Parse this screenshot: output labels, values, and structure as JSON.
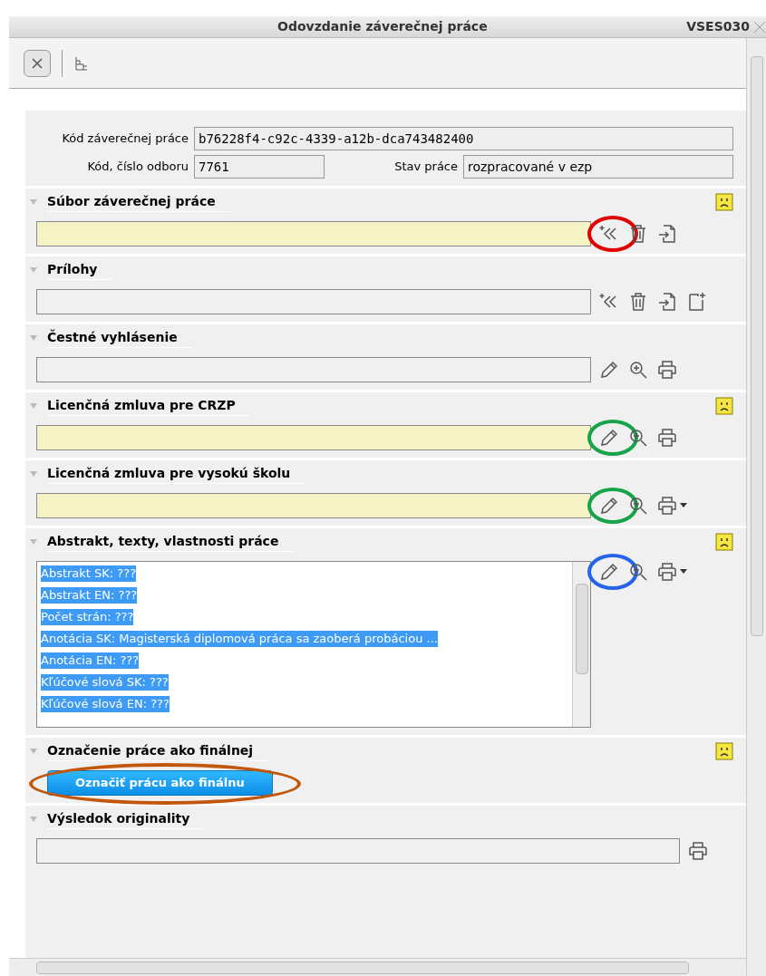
{
  "window": {
    "title": "Odovzdanie záverečnej práce",
    "code": "VSES030"
  },
  "toolbar": [
    {
      "kind": "close"
    },
    {
      "kind": "tree"
    }
  ],
  "header_fields": [
    {
      "label": "Kód záverečnej práce",
      "value": "b76228f4-c92c-4339-a12b-dca743482400"
    },
    {
      "label": "Kód, číslo odboru",
      "value": "7761"
    },
    {
      "label": "Stav práce",
      "value": "rozpracované v ezp"
    }
  ],
  "sections": [
    {
      "title": "Súbor záverečnej práce",
      "expanded": true,
      "warning": true,
      "kind": "field",
      "required": true,
      "icons": [
        {
          "kind": "attach",
          "color": "#e00000"
        },
        {
          "kind": "delete"
        },
        {
          "kind": "import"
        }
      ]
    },
    {
      "title": "Prílohy",
      "expanded": true,
      "warning": false,
      "kind": "field",
      "required": false,
      "icons": [
        {
          "kind": "attach"
        },
        {
          "kind": "delete"
        },
        {
          "kind": "import"
        },
        {
          "kind": "new"
        }
      ]
    },
    {
      "title": "Čestné vyhlásenie",
      "expanded": true,
      "warning": false,
      "kind": "field",
      "required": false,
      "icons": [
        {
          "kind": "edit"
        },
        {
          "kind": "zoom"
        },
        {
          "kind": "print"
        }
      ]
    },
    {
      "title": "Licenčná zmluva pre CRZP",
      "expanded": true,
      "warning": true,
      "kind": "field",
      "required": true,
      "icons": [
        {
          "kind": "edit",
          "color": "#16a34a"
        },
        {
          "kind": "zoom"
        },
        {
          "kind": "print"
        }
      ]
    },
    {
      "title": "Licenčná zmluva pre vysokú školu",
      "expanded": true,
      "warning": false,
      "kind": "field",
      "required": true,
      "icons": [
        {
          "kind": "edit",
          "color": "#16a34a"
        },
        {
          "kind": "zoom"
        },
        {
          "kind": "print-menu"
        }
      ]
    },
    {
      "title": "Abstrakt, texty, vlastnosti práce",
      "expanded": true,
      "warning": true,
      "kind": "text",
      "icons": [
        {
          "kind": "edit",
          "color": "#2563eb"
        },
        {
          "kind": "zoom"
        },
        {
          "kind": "print-menu"
        }
      ],
      "lines": [
        "Abstrakt SK: ???",
        "Abstrakt EN: ???",
        "Počet strán: ???",
        "Anotácia SK: Magisterská diplomová práca sa zaoberá probáciou  ...",
        "Anotácia EN: ???",
        "Kľúčové slová SK: ???",
        "Kľúčové slová EN: ???"
      ]
    },
    {
      "title": "Označenie práce ako finálnej",
      "expanded": true,
      "warning": true,
      "kind": "button",
      "button": "Označiť  prácu ako finálnu",
      "color": "#c2570c"
    },
    {
      "title": "Výsledok originality",
      "expanded": true,
      "warning": false,
      "kind": "field",
      "required": false,
      "icons": [
        {
          "kind": "print"
        }
      ]
    }
  ]
}
